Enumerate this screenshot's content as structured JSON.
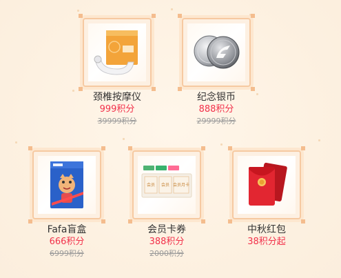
{
  "products": [
    {
      "name": "颈椎按摩仪",
      "price": "999积分",
      "original": "39999积分",
      "icon": "neck-massager-icon"
    },
    {
      "name": "纪念银币",
      "price": "888积分",
      "original": "29999积分",
      "icon": "silver-coin-icon"
    },
    {
      "name": "Fafa盲盒",
      "price": "666积分",
      "original": "6999积分",
      "icon": "blind-box-icon"
    },
    {
      "name": "会员卡券",
      "price": "388积分",
      "original": "2000积分",
      "icon": "membership-card-icon"
    },
    {
      "name": "中秋红包",
      "price": "38积分起",
      "original": "",
      "icon": "red-envelope-icon"
    }
  ],
  "card_texts": {
    "tag_1": "会员",
    "tag_2": "会员",
    "tag_3": "会员月卡"
  },
  "colors": {
    "price": "#f2304a",
    "original_price": "#999999",
    "frame_border": "#f6c9a1",
    "background": "#fdf2e3"
  }
}
